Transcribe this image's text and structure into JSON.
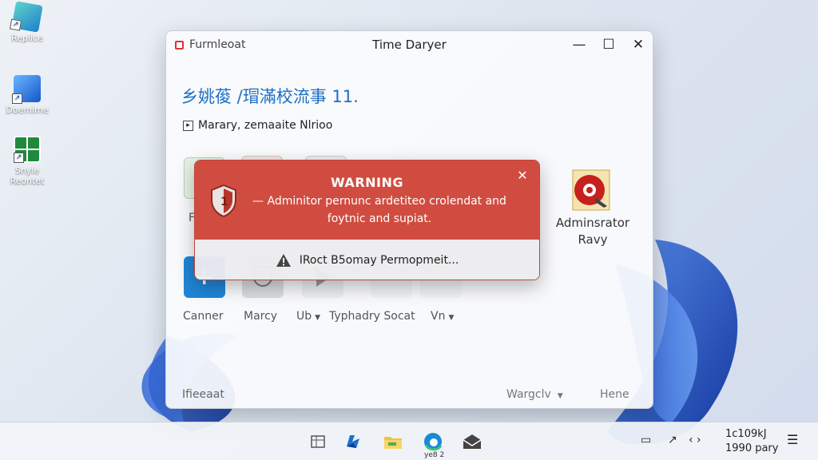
{
  "desktop": {
    "icons": [
      {
        "label": "Replice",
        "icon": "teal-cube-icon"
      },
      {
        "label": "Doemime",
        "icon": "blue-box-icon"
      },
      {
        "label": "Snyle\nReontet",
        "icon": "green-grid-icon"
      }
    ]
  },
  "window": {
    "app_name": "Furmleoat",
    "title": "Time Daryer",
    "headline": "乡姚葰 /瑁滿校流事 11.",
    "subline": "Marary, zemaaite Nlrioo",
    "tiles": [
      {
        "label": "F",
        "icon": "green-doc-icon"
      },
      {
        "label": "",
        "icon": "red-figure-icon"
      },
      {
        "label": "",
        "icon": "gray-box-icon"
      },
      {
        "label": "Canner",
        "icon": "blue-plus-icon"
      },
      {
        "label": "Marcy",
        "icon": "shield-check-icon"
      },
      {
        "label": "Ub",
        "icon": "play-icon",
        "dropdown": true
      },
      {
        "label": "Typhadry Socat",
        "icon": "none"
      },
      {
        "label": "Vn",
        "icon": "none",
        "dropdown": true
      }
    ],
    "admin_item": {
      "label_line1": "Adminsrator",
      "label_line2": "Ravy",
      "icon": "red-disc-icon"
    },
    "footer": {
      "left": "Ifieeaat",
      "dropdown": "Wargclv",
      "right": "Hene"
    }
  },
  "warning": {
    "title": "WARNING",
    "message": "— Adminitor pernunc ardetiteo crolendat and foytnic and supiat.",
    "action": "IRoct B5omay Permopmeit...",
    "colors": {
      "banner": "#d14c40",
      "footer": "#ececee"
    }
  },
  "taskbar": {
    "apps": [
      "widgets-icon",
      "copilot-icon",
      "file-explorer-icon",
      "edge-icon",
      "mail-icon"
    ],
    "app_caption": "ye8 2",
    "tray": [
      "battery-icon",
      "wifi-icon",
      "volume-icon"
    ],
    "clock_time": "1c109kJ",
    "clock_date": "1990 pary"
  }
}
